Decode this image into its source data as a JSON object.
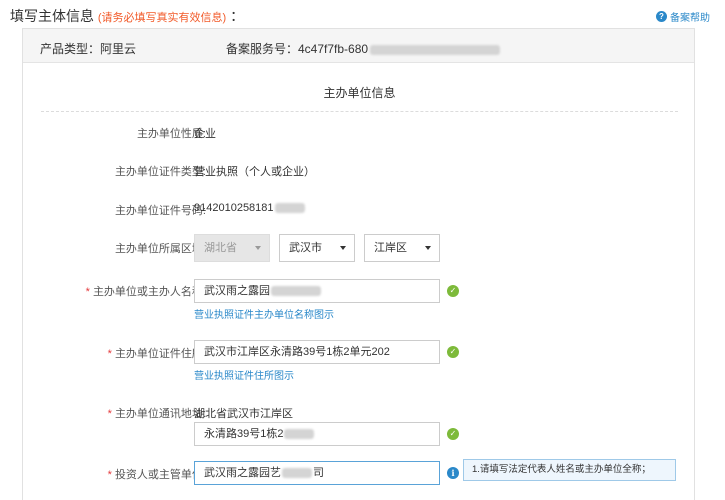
{
  "header": {
    "title": "填写主体信息",
    "hint": "(请务必填写真实有效信息)",
    "colon": "：",
    "help_label": "备案帮助"
  },
  "info_bar": {
    "product_type": "产品类型：阿里云",
    "service_no": "备案服务号：4c47f7fb-680"
  },
  "section_title": "主办单位信息",
  "form": {
    "nature": {
      "label": "主办单位性质:",
      "value": "企业"
    },
    "cert_type": {
      "label": "主办单位证件类型:",
      "value": "营业执照（个人或企业）"
    },
    "cert_no": {
      "label": "主办单位证件号码:",
      "value": "9142010258181"
    },
    "region": {
      "label": "主办单位所属区域:",
      "province": "湖北省",
      "city": "武汉市",
      "district": "江岸区"
    },
    "name": {
      "label": "主办单位或主办人名称:",
      "value": "武汉雨之露园",
      "link": "营业执照证件主办单位名称图示"
    },
    "address": {
      "label": "主办单位证件住所:",
      "value": "武汉市江岸区永清路39号1栋2单元202",
      "link": "营业执照证件住所图示"
    },
    "mail_address": {
      "label": "主办单位通讯地址:",
      "prefix": "湖北省武汉市江岸区",
      "value": "永清路39号1栋2"
    },
    "investor": {
      "label": "投资人或主管单位:",
      "value": "武汉雨之露园艺",
      "value_suffix": "司",
      "tooltip": "1.请填写法定代表人姓名或主办单位全称；"
    }
  },
  "icons": {
    "help": "help-circle-icon",
    "ok": "check-circle-icon",
    "info": "info-circle-icon"
  },
  "colors": {
    "accent": "#2a88c9",
    "hint": "#f25a29",
    "success": "#7dba3a",
    "required": "#e4393c"
  }
}
